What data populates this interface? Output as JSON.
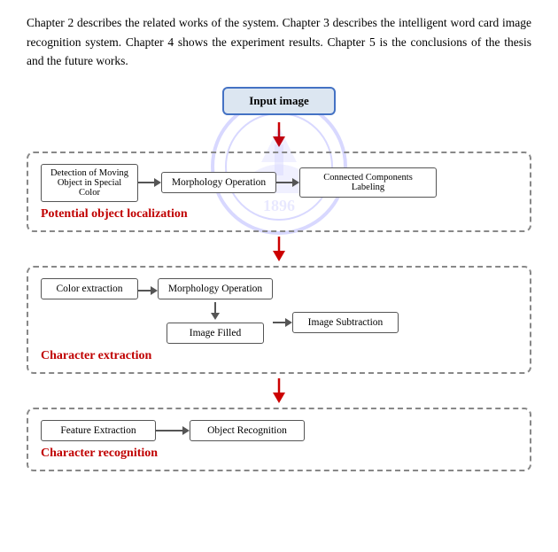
{
  "paragraph": {
    "text": "Chapter 2 describes the related works of the system. Chapter 3 describes the intelligent word card image recognition system. Chapter 4 shows the experiment results. Chapter 5 is the conclusions of the thesis and the future works."
  },
  "diagram": {
    "input_image": "Input image",
    "section1": {
      "label": "Potential object localization",
      "box1": "Detection of Moving\nObject in Special Color",
      "box2": "Morphology Operation",
      "box3": "Connected Components Labeling"
    },
    "section2": {
      "label": "Character extraction",
      "box1": "Color extraction",
      "box2": "Morphology Operation",
      "box3": "Image Filled",
      "box4": "Image Subtraction"
    },
    "section3": {
      "label": "Character recognition",
      "box1": "Feature Extraction",
      "box2": "Object Recognition"
    }
  }
}
